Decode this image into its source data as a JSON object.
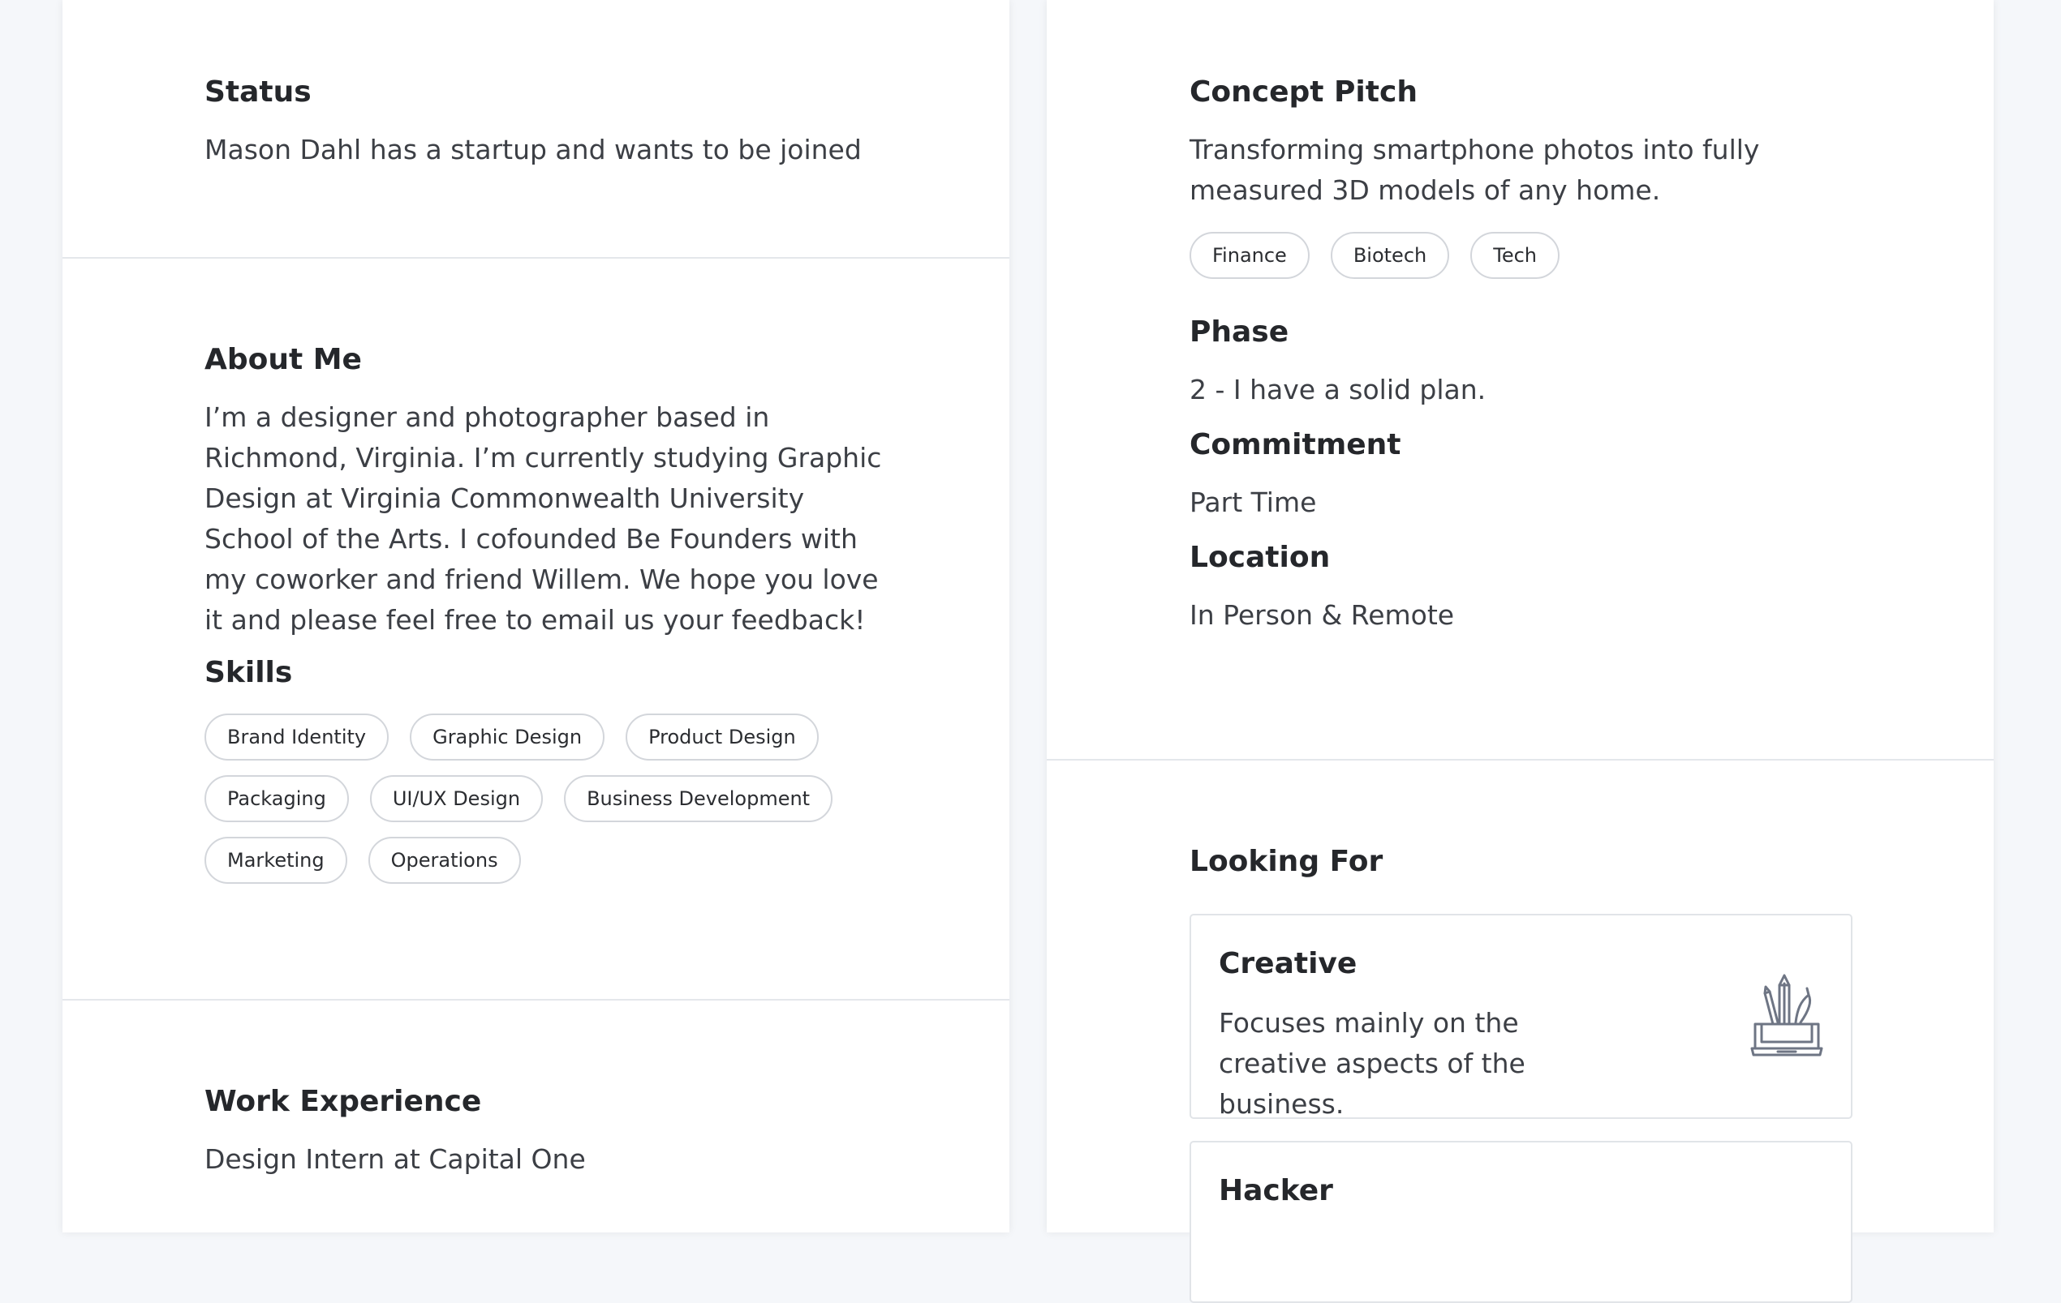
{
  "left_column": {
    "status": {
      "heading": "Status",
      "text": "Mason Dahl has a startup and wants to be joined"
    },
    "about": {
      "heading": "About Me",
      "text": "I’m a designer and photographer based in Richmond, Virginia. I’m currently studying Graphic Design at Virginia Commonwealth University School of the Arts. I cofounded Be Founders with my coworker and friend Willem. We hope you love it and please feel free to email us your feedback!",
      "skills_heading": "Skills",
      "skills": [
        "Brand Identity",
        "Graphic Design",
        "Product Design",
        "Packaging",
        "UI/UX Design",
        "Business Development",
        "Marketing",
        "Operations"
      ]
    },
    "work": {
      "heading": "Work Experience",
      "text": "Design Intern at Capital One"
    }
  },
  "right_column": {
    "concept": {
      "heading": "Concept Pitch",
      "text": "Transforming smartphone photos into fully measured 3D models of any home.",
      "tags": [
        "Finance",
        "Biotech",
        "Tech"
      ]
    },
    "phase": {
      "heading": "Phase",
      "text": "2 - I have a solid plan."
    },
    "commitment": {
      "heading": "Commitment",
      "text": "Part Time"
    },
    "location": {
      "heading": "Location",
      "text": "In Person & Remote"
    },
    "looking_for": {
      "heading": "Looking For",
      "cards": [
        {
          "title": "Creative",
          "description": "Focuses mainly on the creative aspects of the business.",
          "icon": "pencil-cup-laptop-icon"
        },
        {
          "title": "Hacker",
          "description": ""
        }
      ]
    }
  },
  "colors": {
    "background": "#f5f7fa",
    "panel": "#ffffff",
    "divider": "#e4e7eb",
    "text_primary": "#25272b",
    "icon_stroke": "#6e7584"
  }
}
